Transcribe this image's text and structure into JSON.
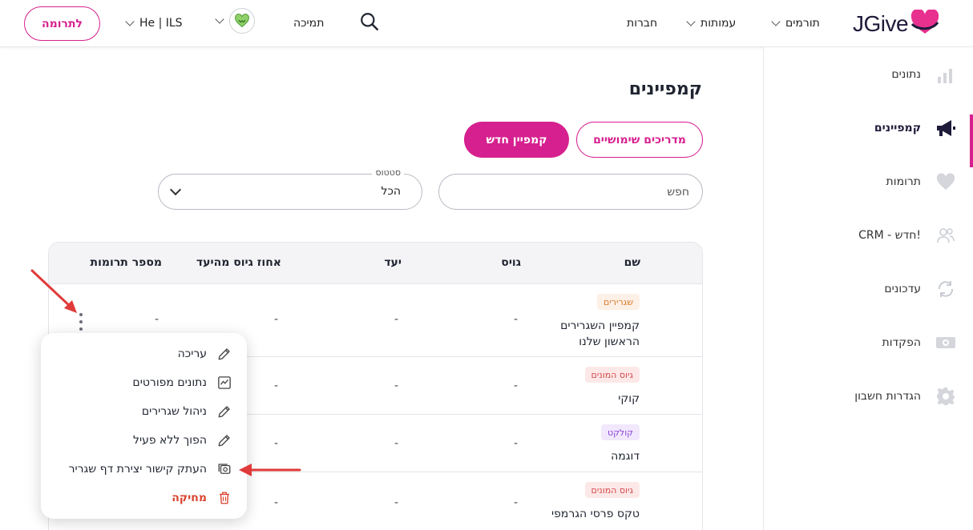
{
  "topbar": {
    "donate_label": "לתרומה",
    "currency_lang": "He | ILS",
    "support": "תמיכה",
    "nav": [
      "תורמים",
      "עמותות",
      "חברות"
    ],
    "logo_text": "JGive"
  },
  "sidebar": {
    "items": [
      {
        "label": "נתונים",
        "icon": "bar-chart-icon"
      },
      {
        "label": "קמפיינים",
        "icon": "megaphone-icon",
        "active": true
      },
      {
        "label": "תרומות",
        "icon": "heart-icon"
      },
      {
        "label": "CRM - חדש!",
        "icon": "users-icon"
      },
      {
        "label": "עדכונים",
        "icon": "refresh-icon"
      },
      {
        "label": "הפקדות",
        "icon": "money-icon"
      },
      {
        "label": "הגדרות חשבון",
        "icon": "gear-icon"
      }
    ]
  },
  "main": {
    "title": "קמפיינים",
    "guides_button": "מדריכים שימושיים",
    "new_button": "קמפיין חדש",
    "search_placeholder": "חפש",
    "status_label": "סטטוס",
    "status_value": "הכל"
  },
  "table": {
    "headers": [
      "שם",
      "גויס",
      "יעד",
      "אחוז גיוס מהיעד",
      "מספר תרומות"
    ],
    "rows": [
      {
        "badge": "שגרירים",
        "name_line1": "קמפיין השגרירים",
        "name_line2": "הראשון שלנו",
        "raised": "-",
        "goal": "-",
        "percent": "-",
        "donations": "-"
      },
      {
        "badge": "גיוס המונים",
        "name_line1": "קוקי",
        "name_line2": "",
        "raised": "-",
        "goal": "-",
        "percent": "-",
        "donations": "-"
      },
      {
        "badge": "קולקט",
        "name_line1": "דוגמה",
        "name_line2": "",
        "raised": "-",
        "goal": "-",
        "percent": "-",
        "donations": "-"
      },
      {
        "badge": "גיוס המונים",
        "name_line1": "טקס פרסי הגרמפי",
        "name_line2": "",
        "raised": "-",
        "goal": "-",
        "percent": "-",
        "donations": "-"
      }
    ]
  },
  "menu": {
    "items": [
      {
        "label": "עריכה",
        "icon": "pencil-icon"
      },
      {
        "label": "נתונים מפורטים",
        "icon": "chart-icon"
      },
      {
        "label": "ניהול שגרירים",
        "icon": "pencil-icon"
      },
      {
        "label": "הפוך ללא פעיל",
        "icon": "pencil-icon"
      },
      {
        "label": "העתק קישור יצירת דף שגריר",
        "icon": "copy-link-icon"
      },
      {
        "label": "מחיקה",
        "icon": "trash-icon"
      }
    ]
  },
  "colors": {
    "brand": "#d6208f",
    "danger": "#d9442f",
    "annotation_arrow": "#e03a3a"
  }
}
